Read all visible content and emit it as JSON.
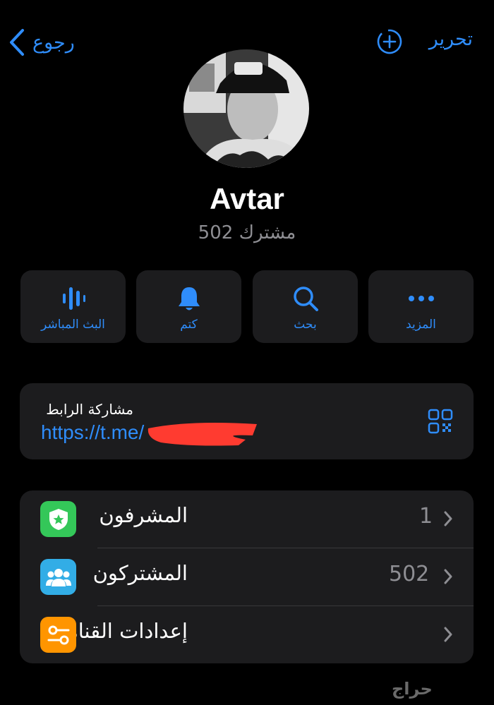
{
  "nav": {
    "back_label": "رجوع",
    "edit_label": "تحرير"
  },
  "profile": {
    "name": "Avtar",
    "subscribers": "502 مشترك"
  },
  "actions": [
    {
      "label": "البث المباشر",
      "icon": "live-stream-icon"
    },
    {
      "label": "كتم",
      "icon": "bell-icon"
    },
    {
      "label": "بحث",
      "icon": "search-icon"
    },
    {
      "label": "المزيد",
      "icon": "more-dots-icon"
    }
  ],
  "share": {
    "title": "مشاركة الرابط",
    "url": "https://t.me/"
  },
  "list": [
    {
      "label": "المشرفون",
      "value": "1",
      "icon": "admin-badge-icon",
      "color": "#34c759"
    },
    {
      "label": "المشتركون",
      "value": "502",
      "icon": "group-icon",
      "color": "#32ade6"
    },
    {
      "label": "إعدادات القناة",
      "value": "",
      "icon": "settings-toggle-icon",
      "color": "#ff9500"
    }
  ],
  "watermark": "حراج",
  "colors": {
    "accent": "#2f8dfb",
    "background": "#000000",
    "card": "#1c1c1e"
  }
}
